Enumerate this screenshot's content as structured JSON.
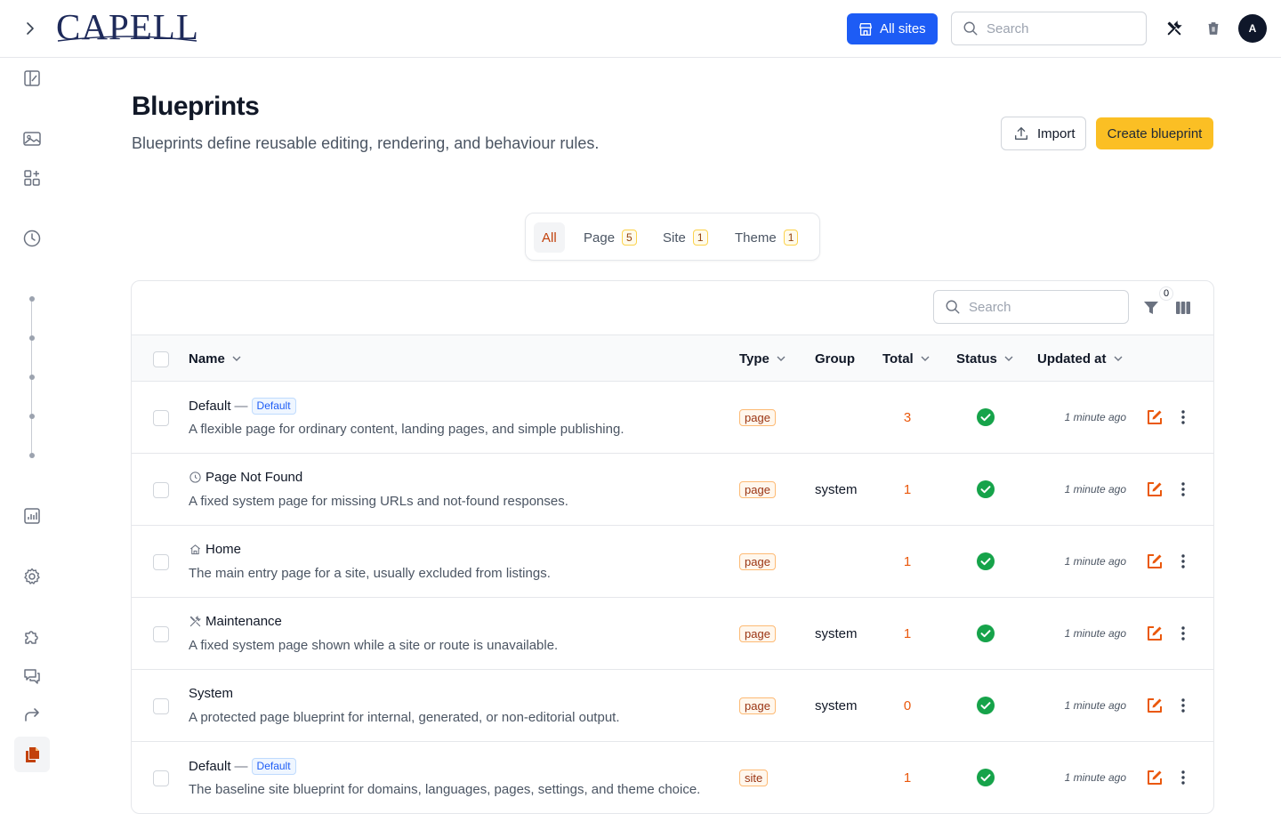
{
  "app": {
    "logo_text": "CAPELL"
  },
  "topbar": {
    "all_sites_label": "All sites",
    "search_placeholder": "Search",
    "avatar_initial": "A"
  },
  "page": {
    "title": "Blueprints",
    "subtitle": "Blueprints define reusable editing, rendering, and behaviour rules.",
    "import_label": "Import",
    "create_label": "Create blueprint"
  },
  "tabs": [
    {
      "label": "All",
      "count": ""
    },
    {
      "label": "Page",
      "count": "5"
    },
    {
      "label": "Site",
      "count": "1"
    },
    {
      "label": "Theme",
      "count": "1"
    }
  ],
  "table": {
    "search_placeholder": "Search",
    "filter_count": "0",
    "columns": {
      "name": "Name",
      "type": "Type",
      "group": "Group",
      "total": "Total",
      "status": "Status",
      "updated": "Updated at"
    },
    "rows": [
      {
        "name": "Default",
        "is_default": true,
        "default_label": "Default",
        "icon": "",
        "description": "A flexible page for ordinary content, landing pages, and simple publishing.",
        "type": "page",
        "group": "",
        "total": "3",
        "status": "active",
        "updated": "1 minute ago"
      },
      {
        "name": "Page Not Found",
        "is_default": false,
        "default_label": "",
        "icon": "clock-icon",
        "description": "A fixed system page for missing URLs and not-found responses.",
        "type": "page",
        "group": "system",
        "total": "1",
        "status": "active",
        "updated": "1 minute ago"
      },
      {
        "name": "Home",
        "is_default": false,
        "default_label": "",
        "icon": "home-icon",
        "description": "The main entry page for a site, usually excluded from listings.",
        "type": "page",
        "group": "",
        "total": "1",
        "status": "active",
        "updated": "1 minute ago"
      },
      {
        "name": "Maintenance",
        "is_default": false,
        "default_label": "",
        "icon": "tools-icon",
        "description": "A fixed system page shown while a site or route is unavailable.",
        "type": "page",
        "group": "system",
        "total": "1",
        "status": "active",
        "updated": "1 minute ago"
      },
      {
        "name": "System",
        "is_default": false,
        "default_label": "",
        "icon": "",
        "description": "A protected page blueprint for internal, generated, or non-editorial output.",
        "type": "page",
        "group": "system",
        "total": "0",
        "status": "active",
        "updated": "1 minute ago"
      },
      {
        "name": "Default",
        "is_default": true,
        "default_label": "Default",
        "icon": "",
        "description": "The baseline site blueprint for domains, languages, pages, settings, and theme choice.",
        "type": "site",
        "group": "",
        "total": "1",
        "status": "active",
        "updated": "1 minute ago"
      }
    ]
  },
  "colors": {
    "primary": "#1d5cf5",
    "accent": "#fbbf24",
    "orange": "#ea580c",
    "success": "#16a34a"
  }
}
